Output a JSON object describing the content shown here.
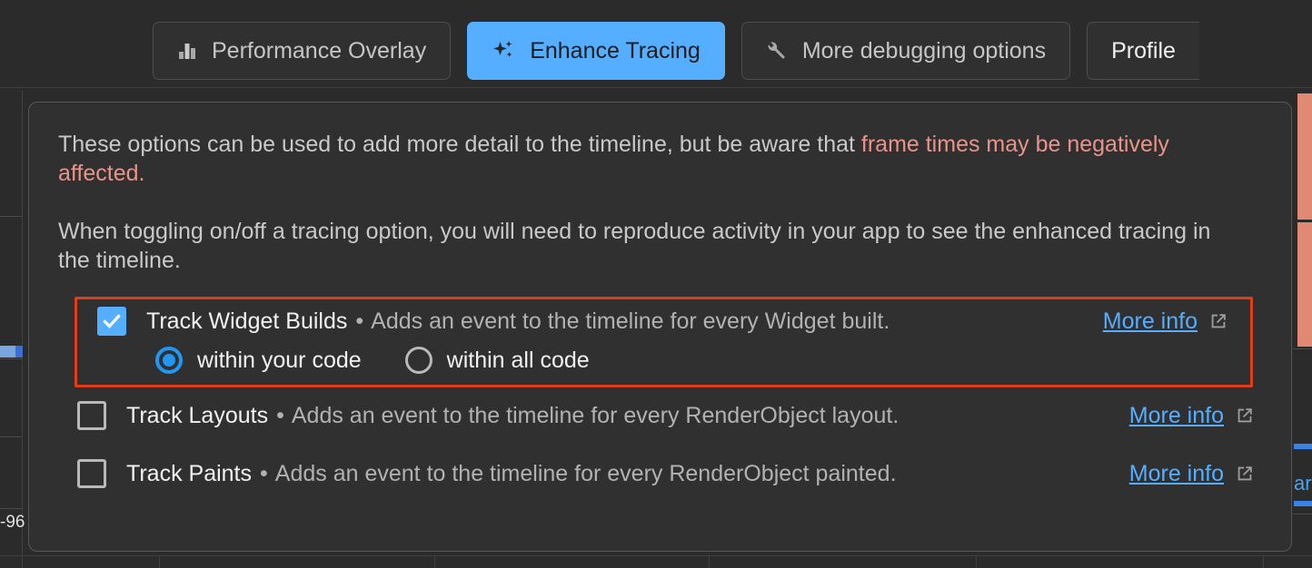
{
  "toolbar": {
    "buttons": [
      {
        "label": "Performance Overlay",
        "icon": "bar-chart-icon",
        "active": false
      },
      {
        "label": "Enhance Tracing",
        "icon": "sparkle-icon",
        "active": true
      },
      {
        "label": "More debugging options",
        "icon": "wrench-icon",
        "active": false
      },
      {
        "label": "Profile",
        "icon": "none",
        "active": false
      }
    ]
  },
  "panel": {
    "paragraph_1_part_1": "These options can be used to add more detail to the timeline, but be aware that ",
    "paragraph_1_warn": "frame times may be negatively affected",
    "paragraph_1_part_2": ".",
    "paragraph_2": "When toggling on/off a tracing option, you will need to reproduce activity in your app to see the enhanced tracing in the timeline.",
    "options": [
      {
        "title": "Track Widget Builds",
        "separator": "•",
        "description": "Adds an event to the timeline for every Widget built.",
        "checked": true,
        "more_info": "More info",
        "sub_options": [
          {
            "label": "within your code",
            "selected": true
          },
          {
            "label": "within all code",
            "selected": false
          }
        ]
      },
      {
        "title": "Track Layouts",
        "separator": "•",
        "description": "Adds an event to the timeline for every RenderObject layout.",
        "checked": false,
        "more_info": "More info"
      },
      {
        "title": "Track Paints",
        "separator": "•",
        "description": "Adds an event to the timeline for every RenderObject painted.",
        "checked": false,
        "more_info": "More info"
      }
    ]
  },
  "background": {
    "axis_label": "-96",
    "partial_link": "ar",
    "colors": {
      "accent_blue": "#55aeff",
      "warning_salmon": "#e8948a",
      "highlight_red": "#e03e1a",
      "panel_bg": "#303030",
      "page_bg": "#2b2b2b"
    }
  }
}
